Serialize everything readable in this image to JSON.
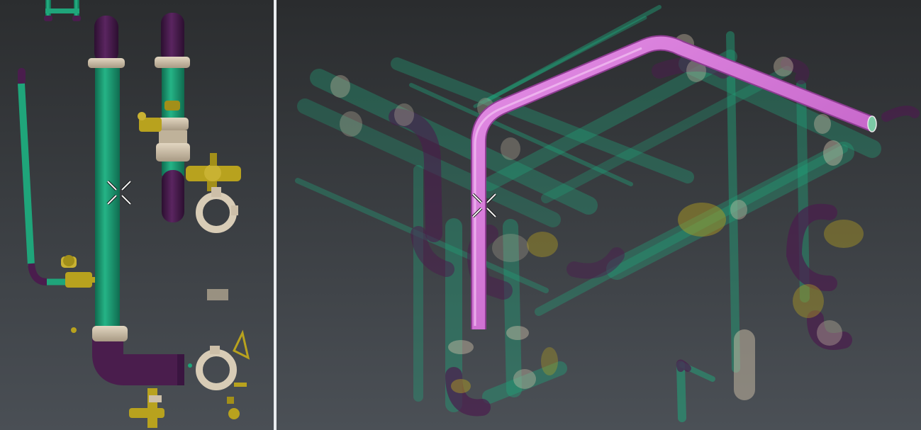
{
  "colors": {
    "background_top": "#2b2d2f",
    "background_bottom": "#4a4f55",
    "pipe_green": "#1fa57a",
    "pipe_purple": "#4a1d4d",
    "flange_beige": "#cdbfa8",
    "valve_yellow": "#b8a21e",
    "selected_pipe": "#d36ad6",
    "divider": "#e9ecef"
  },
  "viewports": [
    {
      "id": "left",
      "view": "side",
      "cursor": "crosshair-icon"
    },
    {
      "id": "right",
      "view": "isometric",
      "cursor": "crosshair-icon",
      "selected_object": "pipe"
    }
  ]
}
